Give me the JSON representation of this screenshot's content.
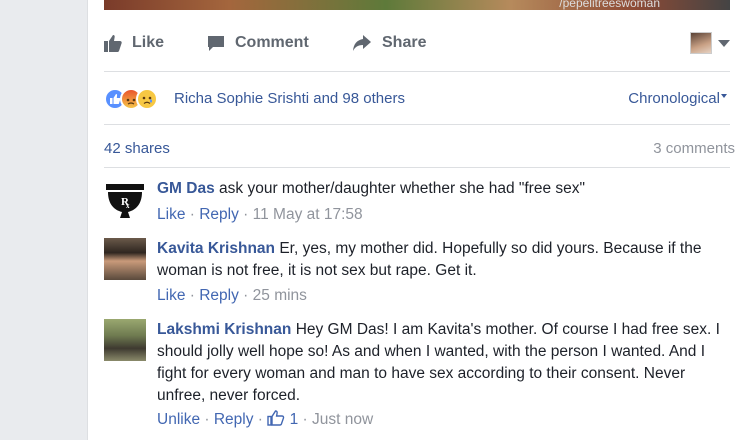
{
  "photo": {
    "watermark": "/pepelitreeswoman"
  },
  "actions": {
    "like_label": "Like",
    "comment_label": "Comment",
    "share_label": "Share"
  },
  "reactions": {
    "names": "Richa Sophie Srishti and 98 others",
    "order_label": "Chronological"
  },
  "stats": {
    "shares": "42 shares",
    "comments": "3 comments"
  },
  "comments": [
    {
      "author": "GM Das",
      "text": "ask your mother/daughter whether she had \"free sex\"",
      "like": "Like",
      "reply": "Reply",
      "time": "11 May at 17:58",
      "sep1": " · ",
      "sep2": " · "
    },
    {
      "author": "Kavita Krishnan",
      "text": "Er, yes, my mother did. Hopefully so did yours. Because if the woman is not free, it is not sex but rape. Get it.",
      "like": "Like",
      "reply": "Reply",
      "time": "25 mins",
      "sep1": " · ",
      "sep2": " · "
    },
    {
      "author": "Lakshmi Krishnan",
      "text": "Hey GM Das! I am Kavita's mother. Of course I had free sex. I should jolly well hope so! As and when I wanted, with the person I wanted. And I fight for every woman and man to have sex according to their consent. Never unfree, never forced.",
      "like": "Unlike",
      "reply": "Reply",
      "like_count": "1",
      "time": "Just now",
      "sep1": " · ",
      "sep2": " · ",
      "sep3": " · "
    }
  ],
  "colors": {
    "link": "#385898",
    "meta": "#90949c",
    "action": "#606770"
  }
}
